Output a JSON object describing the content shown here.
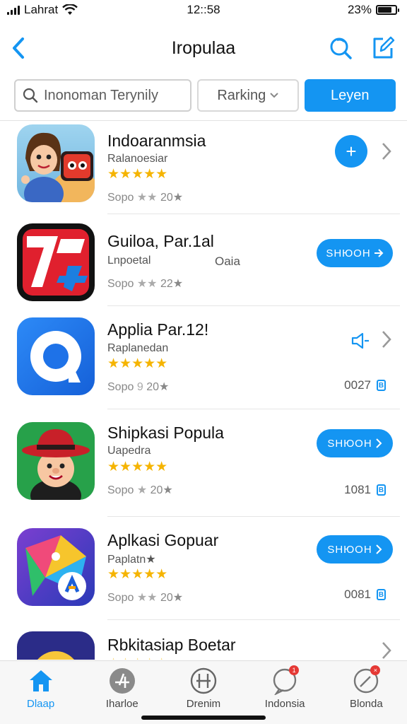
{
  "status_bar": {
    "carrier": "Lahrat",
    "time": "12::58",
    "battery": "23%",
    "battery_level": 0.8
  },
  "nav": {
    "title": "Iropulaa",
    "back_icon": "chevron-left-icon",
    "search_icon": "search-icon",
    "compose_icon": "compose-icon"
  },
  "filters": {
    "search_placeholder": "Inonoman Terynily",
    "ranking_label": "Rarking",
    "primary_label": "Leyen"
  },
  "apps": [
    {
      "name": "Indoaranmsia",
      "subtitle": "Ralanoesiar",
      "stars": "★★★★★",
      "meta_prefix": "Sopo",
      "meta_stars": "★★",
      "meta_suffix": "20★",
      "action": "add",
      "action_label": "+"
    },
    {
      "name": "Guiloa, Par.1al",
      "subtitle": "Lnpoetal",
      "subtitle2": "Oaia",
      "meta_prefix": "Sopo",
      "meta_stars": "★★",
      "meta_suffix": "22★",
      "action": "get",
      "action_label": "SНЮОН"
    },
    {
      "name": "Applia Par.12!",
      "subtitle": "Raplanedan",
      "stars": "★★★★★",
      "meta_prefix": "Sopo",
      "meta_stars": "9",
      "meta_suffix": "20★",
      "action": "speaker",
      "size": "0027"
    },
    {
      "name": "Shipkasi Popula",
      "subtitle": "Uapedra",
      "stars": "★★★★★",
      "meta_prefix": "Sopo",
      "meta_stars": "★",
      "meta_suffix": "20★",
      "action": "get",
      "action_label": "SНЮОН",
      "size": "1081"
    },
    {
      "name": "Aplkasi Gopuar",
      "subtitle": "Paplatn★",
      "stars": "★★★★★",
      "meta_prefix": "Sopo",
      "meta_stars": "★★",
      "meta_suffix": "20★",
      "action": "get",
      "action_label": "SНЮОН",
      "size": "0081"
    },
    {
      "name": "Rbkitasiap Boetar",
      "stars": "★★★★★"
    }
  ],
  "tabs": [
    {
      "label": "Dlaap",
      "icon": "home-icon",
      "active": true
    },
    {
      "label": "Iharloe",
      "icon": "apps-icon"
    },
    {
      "label": "Drenim",
      "icon": "grid-icon"
    },
    {
      "label": "Indonsia",
      "icon": "chat-icon",
      "badge": "1"
    },
    {
      "label": "Blonda",
      "icon": "compass-icon",
      "badge": "×"
    }
  ],
  "colors": {
    "accent": "#1495f2",
    "star": "#f5b400"
  }
}
